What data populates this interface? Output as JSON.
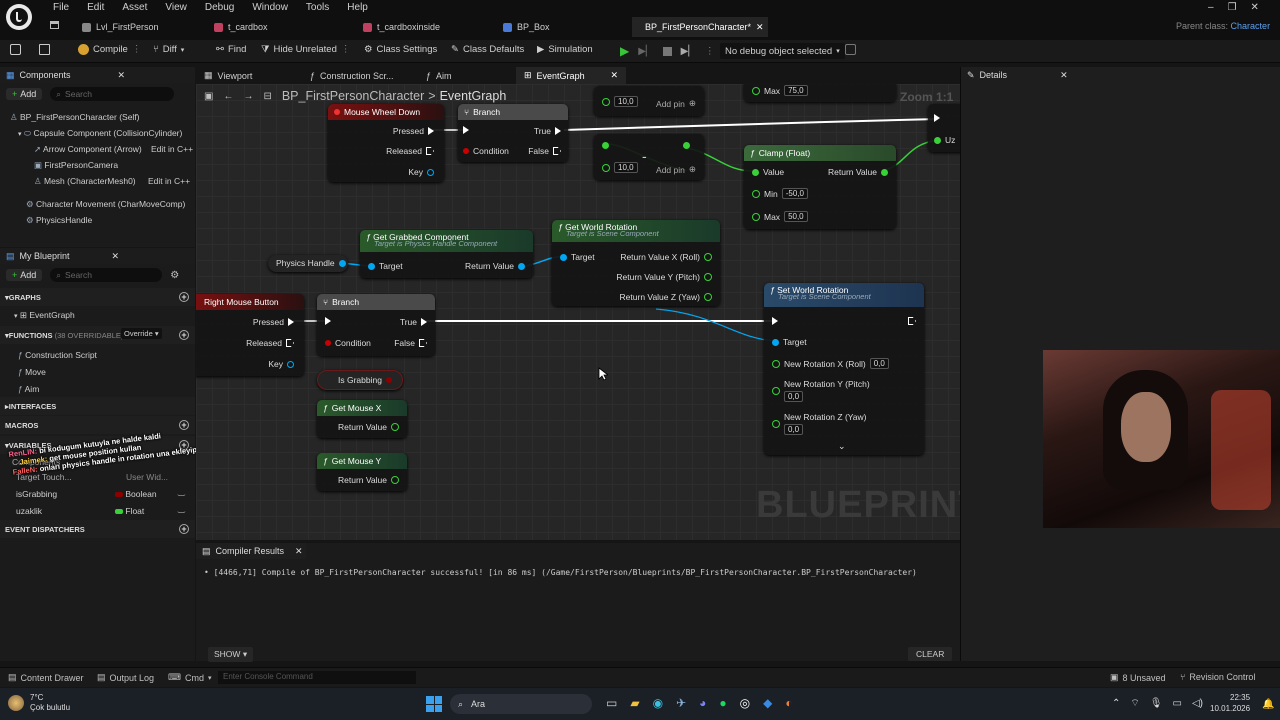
{
  "menu": [
    "File",
    "Edit",
    "Asset",
    "View",
    "Debug",
    "Window",
    "Tools",
    "Help"
  ],
  "tabs": [
    {
      "label": "Lvl_FirstPerson"
    },
    {
      "label": "t_cardbox"
    },
    {
      "label": "t_cardboxinside"
    },
    {
      "label": "BP_Box"
    },
    {
      "label": "BP_FirstPersonCharacter*"
    }
  ],
  "parent_class": {
    "label": "Parent class:",
    "value": "Character"
  },
  "toolbar": {
    "compile": "Compile",
    "diff": "Diff",
    "find": "Find",
    "hide_unrelated": "Hide Unrelated",
    "class_settings": "Class Settings",
    "class_defaults": "Class Defaults",
    "simulation": "Simulation",
    "debug_object": "No debug object selected"
  },
  "components": {
    "title": "Components",
    "add": "Add",
    "search_placeholder": "Search",
    "items": [
      {
        "label": "BP_FirstPersonCharacter (Self)"
      },
      {
        "label": "Capsule Component (CollisionCylinder)"
      },
      {
        "label": "Arrow Component (Arrow)",
        "action": "Edit in C++"
      },
      {
        "label": "FirstPersonCamera"
      },
      {
        "label": "Mesh (CharacterMesh0)",
        "action": "Edit in C++"
      },
      {
        "label": "Character Movement (CharMoveComp)"
      },
      {
        "label": "PhysicsHandle"
      }
    ]
  },
  "myblueprint": {
    "title": "My Blueprint",
    "add": "Add",
    "search_placeholder": "Search",
    "graphs_header": "GRAPHS",
    "graphs": [
      "EventGraph"
    ],
    "functions_header": "FUNCTIONS",
    "functions_count": "(38 OVERRIDABLE)",
    "override": "Override",
    "functions": [
      "Construction Script",
      "Move",
      "Aim"
    ],
    "interfaces_header": "INTERFACES",
    "macros_header": "MACROS",
    "variables_header": "VARIABLES",
    "variables": [
      {
        "name": "Components",
        "type": ""
      },
      {
        "name": "Target Touch...",
        "type": "User Wid..."
      },
      {
        "name": "isGrabbing",
        "type": "Boolean",
        "color": "#8c0000"
      },
      {
        "name": "uzaklik",
        "type": "Float",
        "color": "#38d138"
      }
    ],
    "event_dispatchers_header": "EVENT DISPATCHERS"
  },
  "chat": [
    {
      "user": "RenLIN:",
      "text": "bi kodugum kutuyla ne halde kaldi"
    },
    {
      "user": "Jaimek:",
      "text": "get mouse position kullan"
    },
    {
      "user": "FalleN:",
      "text": "onları physics handle in rotation una ekleyip set e ver"
    }
  ],
  "editor_tabs": [
    {
      "label": "Viewport"
    },
    {
      "label": "Construction Scr..."
    },
    {
      "label": "Aim"
    },
    {
      "label": "EventGraph"
    }
  ],
  "breadcrumb": {
    "root": "BP_FirstPersonCharacter",
    "sep": ">",
    "current": "EventGraph"
  },
  "zoom": "Zoom 1:1",
  "watermark": "BLUEPRINT",
  "nodes": {
    "mouse_wheel": {
      "title": "Mouse Wheel Down",
      "pressed": "Pressed",
      "released": "Released",
      "key": "Key"
    },
    "branch1": {
      "title": "Branch",
      "condition": "Condition",
      "true": "True",
      "false": "False"
    },
    "add_top": {
      "value": "10,0",
      "add_pin": "Add pin"
    },
    "max_top": {
      "label": "Max",
      "value": "75,0"
    },
    "add_mid": {
      "value": "10,0",
      "add_pin": "Add pin",
      "op": "-"
    },
    "clamp": {
      "title": "Clamp (Float)",
      "value": "Value",
      "return": "Return Value",
      "min_label": "Min",
      "min": "-50,0",
      "max_label": "Max",
      "max": "50,0"
    },
    "physics_handle": {
      "label": "Physics Handle"
    },
    "get_grabbed": {
      "title": "Get Grabbed Component",
      "subtitle": "Target is Physics Handle Component",
      "target": "Target",
      "return": "Return Value"
    },
    "get_world_rotation": {
      "title": "Get World Rotation",
      "subtitle": "Target is Scene Component",
      "target": "Target",
      "rx": "Return Value X (Roll)",
      "ry": "Return Value Y (Pitch)",
      "rz": "Return Value Z (Yaw)"
    },
    "right_mouse": {
      "title": "Right Mouse Button",
      "pressed": "Pressed",
      "released": "Released",
      "key": "Key"
    },
    "branch2": {
      "title": "Branch",
      "condition": "Condition",
      "true": "True",
      "false": "False"
    },
    "is_grabbing": {
      "label": "Is Grabbing"
    },
    "get_mouse_x": {
      "title": "Get Mouse X",
      "return": "Return Value"
    },
    "get_mouse_y": {
      "title": "Get Mouse Y",
      "return": "Return Value"
    },
    "set_world_rotation": {
      "title": "Set World Rotation",
      "subtitle": "Target is Scene Component",
      "target": "Target",
      "nx": "New Rotation X (Roll)",
      "nx_val": "0,0",
      "ny": "New Rotation Y (Pitch)",
      "ny_val": "0,0",
      "nz": "New Rotation Z (Yaw)",
      "nz_val": "0,0"
    },
    "offscreen": {
      "label": "Uz"
    }
  },
  "details": {
    "title": "Details"
  },
  "compiler": {
    "title": "Compiler Results",
    "message": "[4466,71] Compile of BP_FirstPersonCharacter successful! [in 86 ms] (/Game/FirstPerson/Blueprints/BP_FirstPersonCharacter.BP_FirstPersonCharacter)",
    "show": "SHOW",
    "clear": "CLEAR"
  },
  "status": {
    "content_drawer": "Content Drawer",
    "output_log": "Output Log",
    "cmd": "Cmd",
    "console_placeholder": "Enter Console Command",
    "unsaved": "8 Unsaved",
    "revision": "Revision Control"
  },
  "taskbar": {
    "temp": "7°C",
    "weather": "Çok bulutlu",
    "search": "Ara",
    "time": "22:35",
    "date": "10.01.2026"
  },
  "colors": {
    "exec": "#ffffff",
    "object": "#00a8f4",
    "float": "#38d138",
    "bool": "#8c0000",
    "event_head": "#7a1010",
    "func_head": "#4a6a3a",
    "pure_head": "#3a5a6a",
    "accent": "#0070e0"
  }
}
